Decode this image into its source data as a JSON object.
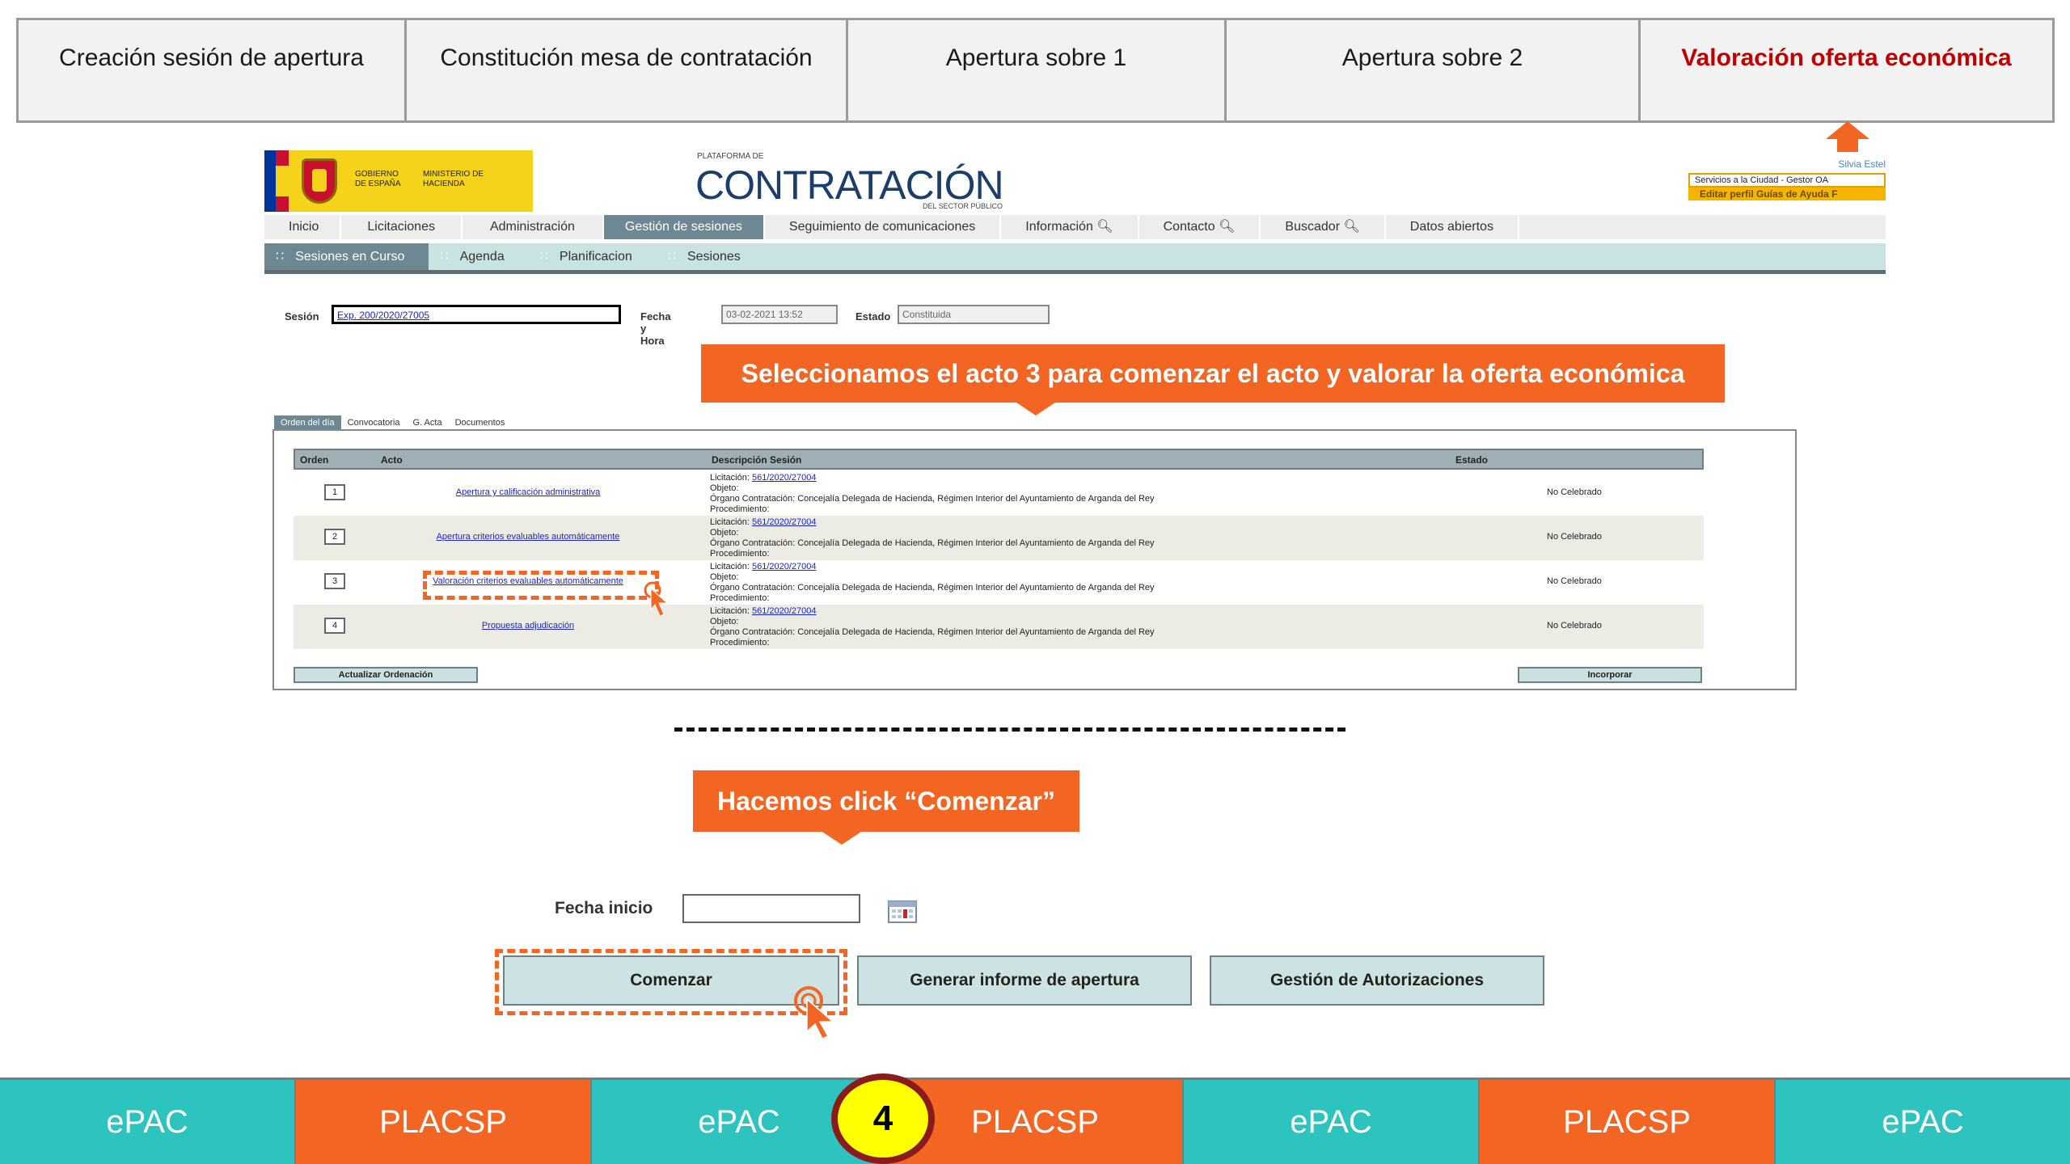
{
  "steps": [
    {
      "label": "Creación sesión de apertura",
      "active": false
    },
    {
      "label": "Constitución mesa de contratación",
      "active": false
    },
    {
      "label": "Apertura sobre 1",
      "active": false
    },
    {
      "label": "Apertura sobre 2",
      "active": false
    },
    {
      "label": "Valoración oferta económica",
      "active": true
    }
  ],
  "header": {
    "gov_line1": "GOBIERNO DE ESPAÑA",
    "gov_line2": "MINISTERIO DE HACIENDA",
    "platform_small": "PLATAFORMA DE",
    "platform_big": "CONTRATACIÓN",
    "platform_sub": "DEL SECTOR PÚBLICO",
    "user_name": "Silvia Estel",
    "user_org": "Servicios a la Ciudad - Gestor OA",
    "user_links": "Editar perfil   Guías de Ayuda   F"
  },
  "main_nav": [
    "Inicio",
    "Licitaciones",
    "Administración",
    "Gestión de sesiones",
    "Seguimiento de comunicaciones",
    "Información",
    "Contacto",
    "Buscador",
    "Datos abiertos"
  ],
  "sub_nav": [
    "Sesiones en Curso",
    "Agenda",
    "Planificacion",
    "Sesiones"
  ],
  "session": {
    "sesion_label": "Sesión",
    "sesion_value": "Exp. 200/2020/27005",
    "fecha_label": "Fecha y Hora",
    "fecha_value": "03-02-2021 13:52",
    "estado_label": "Estado",
    "estado_value": "Constituida"
  },
  "callouts": {
    "first": "Seleccionamos el acto 3 para comenzar el acto y valorar la oferta económica",
    "second": "Hacemos click “Comenzar”"
  },
  "tabs": [
    "Orden del día",
    "Convocatoria",
    "G. Acta",
    "Documentos"
  ],
  "table": {
    "headers": {
      "orden": "Orden",
      "acto": "Acto",
      "descripcion": "Descripción Sesión",
      "estado": "Estado"
    },
    "rows": [
      {
        "orden": "1",
        "acto": "Apertura y calificación administrativa",
        "lic_label": "Licitación:",
        "lic": "561/2020/27004",
        "objeto": "Objeto:",
        "organo": "Órgano Contratación: Concejalía Delegada de Hacienda, Régimen Interior del Ayuntamiento de Arganda del Rey",
        "proc": "Procedimiento:",
        "estado": "No Celebrado"
      },
      {
        "orden": "2",
        "acto": "Apertura criterios evaluables automáticamente",
        "lic_label": "Licitación:",
        "lic": "561/2020/27004",
        "objeto": "Objeto:",
        "organo": "Órgano Contratación: Concejalía Delegada de Hacienda, Régimen Interior del Ayuntamiento de Arganda del Rey",
        "proc": "Procedimiento:",
        "estado": "No Celebrado"
      },
      {
        "orden": "3",
        "acto": "Valoración criterios evaluables automáticamente",
        "lic_label": "Licitación:",
        "lic": "561/2020/27004",
        "objeto": "Objeto:",
        "organo": "Órgano Contratación: Concejalía Delegada de Hacienda, Régimen Interior del Ayuntamiento de Arganda del Rey",
        "proc": "Procedimiento:",
        "estado": "No Celebrado"
      },
      {
        "orden": "4",
        "acto": "Propuesta adjudicación",
        "lic_label": "Licitación:",
        "lic": "561/2020/27004",
        "objeto": "Objeto:",
        "organo": "Órgano Contratación: Concejalía Delegada de Hacienda, Régimen Interior del Ayuntamiento de Arganda del Rey",
        "proc": "Procedimiento:",
        "estado": "No Celebrado"
      }
    ],
    "btn_update": "Actualizar Ordenación",
    "btn_incorporar": "Incorporar"
  },
  "form": {
    "fecha_inicio_label": "Fecha inicio",
    "fecha_inicio_value": "",
    "btn_comenzar": "Comenzar",
    "btn_informe": "Generar informe de apertura",
    "btn_autorizaciones": "Gestión de Autorizaciones"
  },
  "bottom": {
    "segments": [
      "ePAC",
      "PLACSP",
      "ePAC",
      "PLACSP",
      "ePAC",
      "PLACSP",
      "ePAC"
    ],
    "step_number": "4"
  },
  "colors": {
    "accent": "#f26522",
    "teal": "#2dc3bf",
    "active_step": "#c00000"
  }
}
